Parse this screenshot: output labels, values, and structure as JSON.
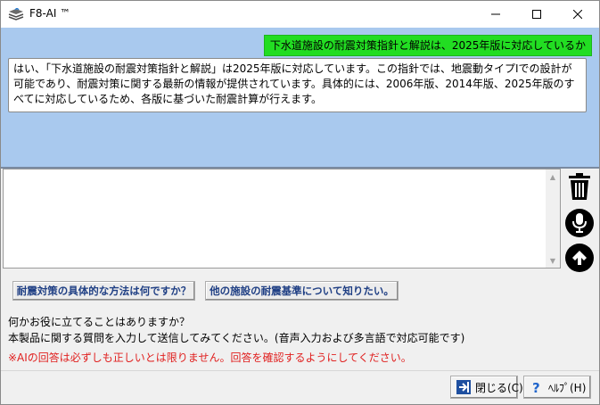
{
  "window": {
    "title": "F8-AI ™",
    "icon": "stack-logo-icon",
    "controls": [
      "minimize-icon",
      "maximize-icon",
      "close-icon"
    ]
  },
  "chat": {
    "user_message": "下水道施設の耐震対策指針と解説は、2025年版に対応しているか",
    "ai_message": "はい、「下水道施設の耐震対策指針と解説」は2025年版に対応しています。この指針では、地震動タイプⅠでの設計が可能であり、耐震対策に関する最新の情報が提供されています。具体的には、2006年版、2014年版、2025年版のすべてに対応しているため、各版に基づいた耐震計算が行えます。",
    "user_bubble_color": "#22dd22",
    "background_color": "#a9c9ee"
  },
  "input": {
    "value": "",
    "placeholder": ""
  },
  "side_buttons": [
    "trash-icon",
    "microphone-icon",
    "send-arrow-up-icon"
  ],
  "suggestions": [
    "耐震対策の具体的な方法は何ですか？",
    "他の施設の耐震基準について知りたい。"
  ],
  "info": {
    "line1": "何かお役に立てることはありますか？",
    "line2": "本製品に関する質問を入力して送信してみてください。(音声入力および多言語で対応可能です)",
    "warning": "※AIの回答は必ずしも正しいとは限りません。回答を確認するようにしてください。",
    "warning_color": "#e0201f"
  },
  "footer": {
    "close_label": "閉じる(C)",
    "help_label": "ﾍﾙﾌﾟ(H)"
  }
}
